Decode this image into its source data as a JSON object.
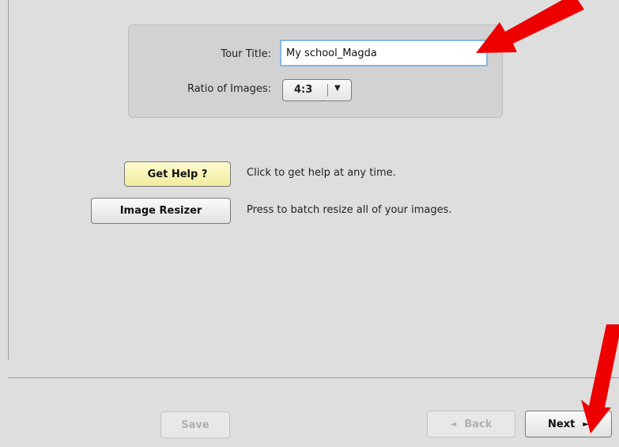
{
  "settings": {
    "tour_title_label": "Tour Title:",
    "tour_title_value": "My school_Magda",
    "ratio_label": "Ratio of Images:",
    "ratio_value": "4:3",
    "ratio_arrow": "▼"
  },
  "actions": {
    "help_label": "Get Help ?",
    "help_desc": "Click to get help at any time.",
    "resizer_label": "Image Resizer",
    "resizer_desc": "Press to batch resize all of your images."
  },
  "footer": {
    "save_label": "Save",
    "back_label": "Back",
    "back_glyph": "◄",
    "next_label": "Next",
    "next_glyph": "►"
  },
  "colors": {
    "annotation_arrow": "#ee0000",
    "input_focus_border": "#7fb7e6",
    "help_button_bg": "#f0ec9e"
  }
}
